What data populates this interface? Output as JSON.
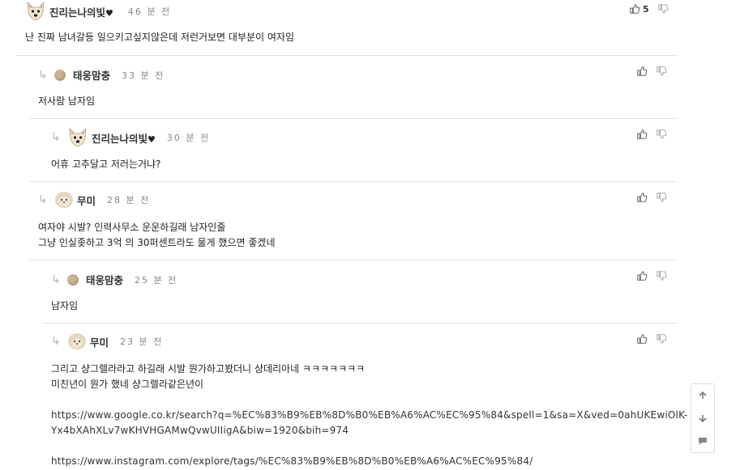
{
  "comments": [
    {
      "nick": "진리는나의빛",
      "heart": "♥",
      "time": "46 분 전",
      "upvotes": "5",
      "lines": [
        "난 진짜 남녀갈등 일으키고싶지않은데 저런거보면 대부분이 여자임"
      ]
    },
    {
      "nick": "태웅맘충",
      "time": "33 분 전",
      "lines": [
        "저사람 남자임"
      ]
    },
    {
      "nick": "진리는나의빛",
      "heart": "♥",
      "time": "30 분 전",
      "lines": [
        "어휴 고추달고 저러는거냐?"
      ]
    },
    {
      "nick": "무미",
      "time": "28 분 전",
      "lines": [
        "여자야 시발? 인력사무소 운운하길래 남자인줄",
        "그냥 인실좆하고 3억 의 30퍼센트라도 물게 했으면 좋겠네"
      ]
    },
    {
      "nick": "태웅맘충",
      "time": "25 분 전",
      "lines": [
        "남자임"
      ]
    },
    {
      "nick": "무미",
      "time": "23 분 전",
      "lines": [
        "그리고 샹그렐라라고 하길래 시발 뭔가하고봤더니 샹데리아네 ㅋㅋㅋㅋㅋㅋㅋ",
        "미친년이 뭔가 했네 샹그렐라같은년이"
      ],
      "links": [
        "https://www.google.co.kr/search?q=%EC%83%B9%EB%8D%B0%EB%A6%AC%EC%95%84&spell=1&sa=X&ved=0ahUKEwiOlK-",
        "Yx4bXAhXLv7wKHVHGAMwQvwUIIigA&biw=1920&bih=974",
        "https://www.instagram.com/explore/tags/%EC%83%B9%EB%8D%B0%EB%A6%AC%EC%95%84/"
      ]
    }
  ],
  "icons": {
    "upvote": "thumbs-up-icon",
    "downvote": "thumbs-down-icon",
    "reply": "reply-arrow-icon"
  },
  "side_panel": [
    "arrow-up-icon",
    "arrow-down-icon",
    "comment-icon"
  ],
  "colors": {
    "separator": "#e2e2e2",
    "time": "#888888",
    "reply_arrow": "#b5b5b5"
  }
}
